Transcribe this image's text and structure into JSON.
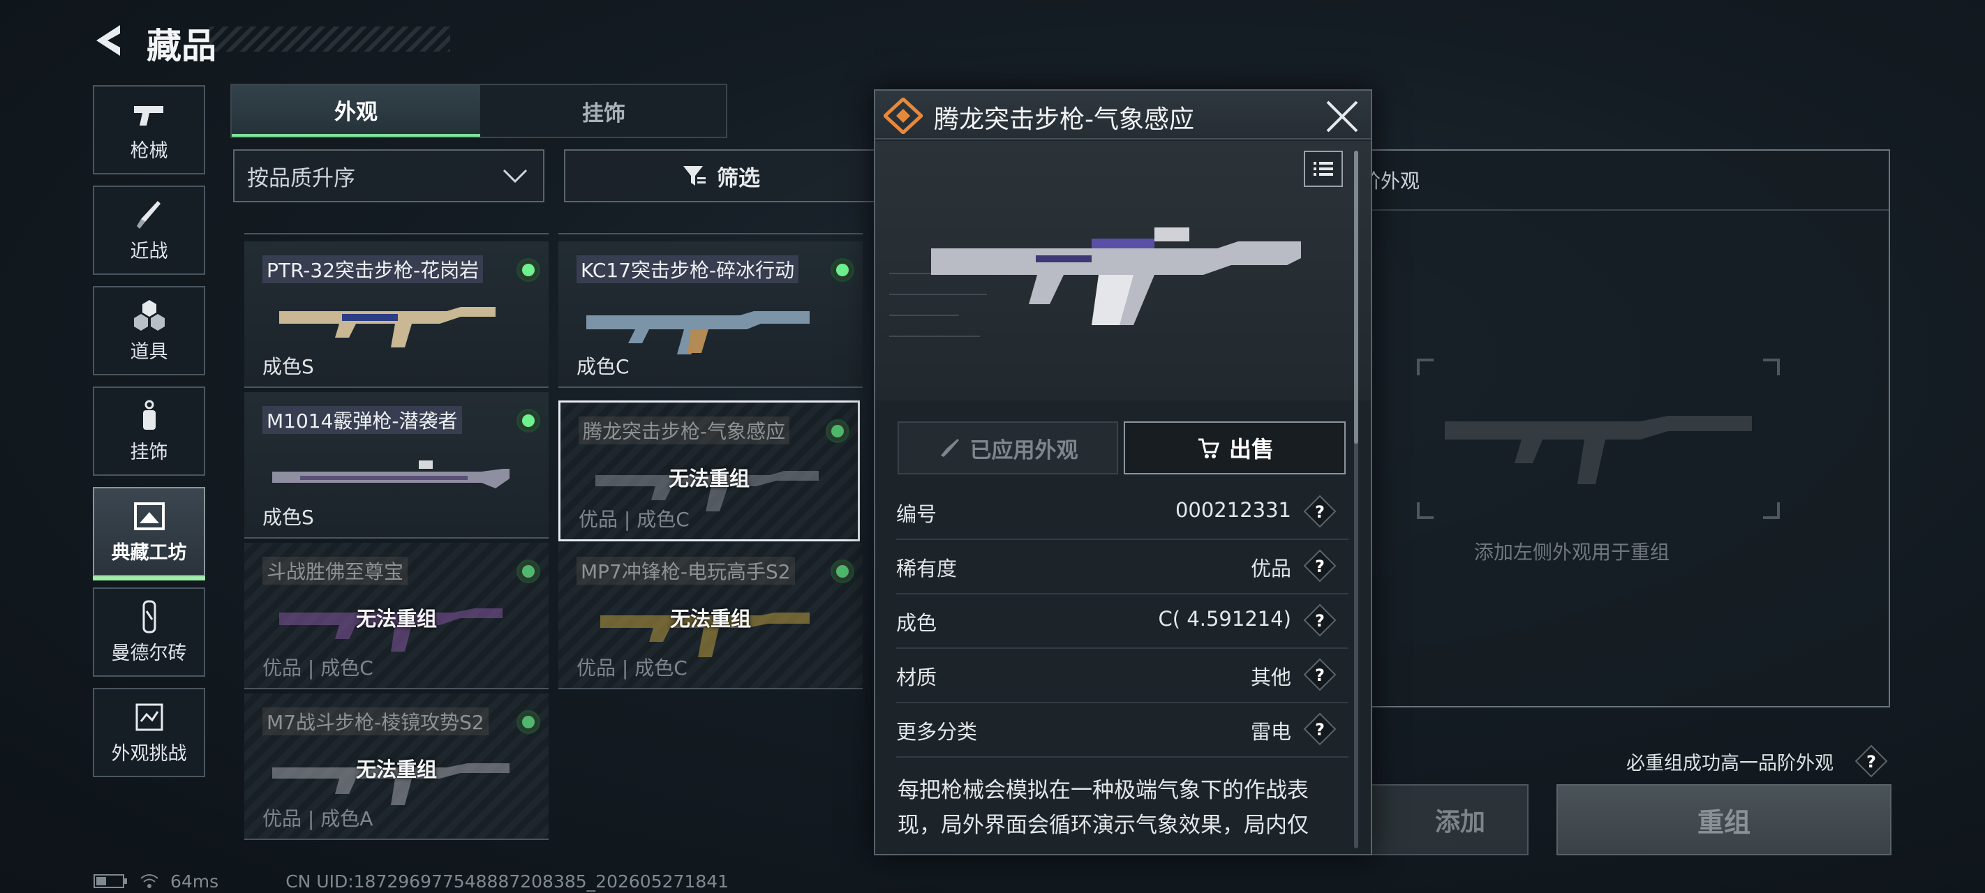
{
  "header": {
    "title": "藏品"
  },
  "nav": [
    {
      "label": "枪械",
      "icon": "pistol-icon"
    },
    {
      "label": "近战",
      "icon": "knife-icon"
    },
    {
      "label": "道具",
      "icon": "grenade-icon"
    },
    {
      "label": "挂饰",
      "icon": "charm-icon"
    },
    {
      "label": "典藏工坊",
      "icon": "workshop-icon",
      "active": true
    },
    {
      "label": "曼德尔砖",
      "icon": "brick-icon"
    },
    {
      "label": "外观挑战",
      "icon": "challenge-icon"
    }
  ],
  "tabs": {
    "appearance": "外观",
    "pendant": "挂饰"
  },
  "sort": {
    "label": "按品质升序"
  },
  "filter": {
    "label": "筛选"
  },
  "grid": {
    "lock_text": "无法重组",
    "items": [
      {
        "name": "PTR-32突击步枪-花岗岩",
        "grade": "成色S",
        "locked": false
      },
      {
        "name": "KC17突击步枪-碎冰行动",
        "grade": "成色C",
        "locked": false
      },
      {
        "name": "M1014霰弹枪-潜袭者",
        "grade": "成色S",
        "locked": false
      },
      {
        "name": "腾龙突击步枪-气象感应",
        "grade": "优品 | 成色C",
        "locked": true,
        "selected": true
      },
      {
        "name": "斗战胜佛至尊宝",
        "grade": "优品 | 成色C",
        "locked": true
      },
      {
        "name": "MP7冲锋枪-电玩高手S2",
        "grade": "优品 | 成色C",
        "locked": true
      },
      {
        "name": "M7战斗步枪-棱镜攻势S2",
        "grade": "优品 | 成色A",
        "locked": true
      }
    ]
  },
  "reforge": {
    "header_label": "阶外观",
    "hint": "添加左侧外观用于重组",
    "guarantee": "必重组成功高一品阶外观",
    "add_label": "添加",
    "reforge_label": "重组"
  },
  "popup": {
    "title": "腾龙突击步枪-气象感应",
    "applied_label": "已应用外观",
    "sell_label": "出售",
    "rows": [
      {
        "label": "编号",
        "value": "000212331"
      },
      {
        "label": "稀有度",
        "value": "优品"
      },
      {
        "label": "成色",
        "value": "C( 4.591214)"
      },
      {
        "label": "材质",
        "value": "其他"
      },
      {
        "label": "更多分类",
        "value": "雷电"
      }
    ],
    "description": "每把枪械会模拟在一种极端气象下的作战表现，局外界面会循环演示气象效果，局内仅"
  },
  "status": {
    "ping": "64ms",
    "uid": "CN UID:187296977548887208385_202605271841"
  },
  "colors": {
    "accent_green": "#6df28d",
    "rarity_orange": "#e8893a",
    "background": "#141c23"
  }
}
